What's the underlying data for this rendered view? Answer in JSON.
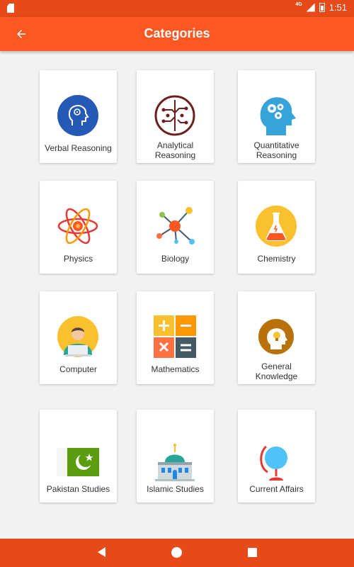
{
  "status_bar": {
    "network": "4G",
    "time": "1:51"
  },
  "app_bar": {
    "title": "Categories",
    "back_icon": "arrow-back-icon"
  },
  "categories": [
    {
      "label": "Verbal Reasoning",
      "icon": "head-brain-icon"
    },
    {
      "label": "Analytical Reasoning",
      "icon": "brain-circuit-icon"
    },
    {
      "label": "Quantitative Reasoning",
      "icon": "head-gears-icon"
    },
    {
      "label": "Physics",
      "icon": "atom-icon"
    },
    {
      "label": "Biology",
      "icon": "molecule-icon"
    },
    {
      "label": "Chemistry",
      "icon": "flask-icon"
    },
    {
      "label": "Computer",
      "icon": "user-laptop-icon"
    },
    {
      "label": "Mathematics",
      "icon": "calculator-operations-icon"
    },
    {
      "label": "General Knowledge",
      "icon": "head-bulb-icon"
    },
    {
      "label": "Pakistan Studies",
      "icon": "pakistan-flag-icon"
    },
    {
      "label": "Islamic Studies",
      "icon": "mosque-icon"
    },
    {
      "label": "Current Affairs",
      "icon": "globe-icon"
    }
  ],
  "colors": {
    "primary": "#ff5722",
    "primary_dark": "#e64a19",
    "background": "#f2f2f2"
  }
}
